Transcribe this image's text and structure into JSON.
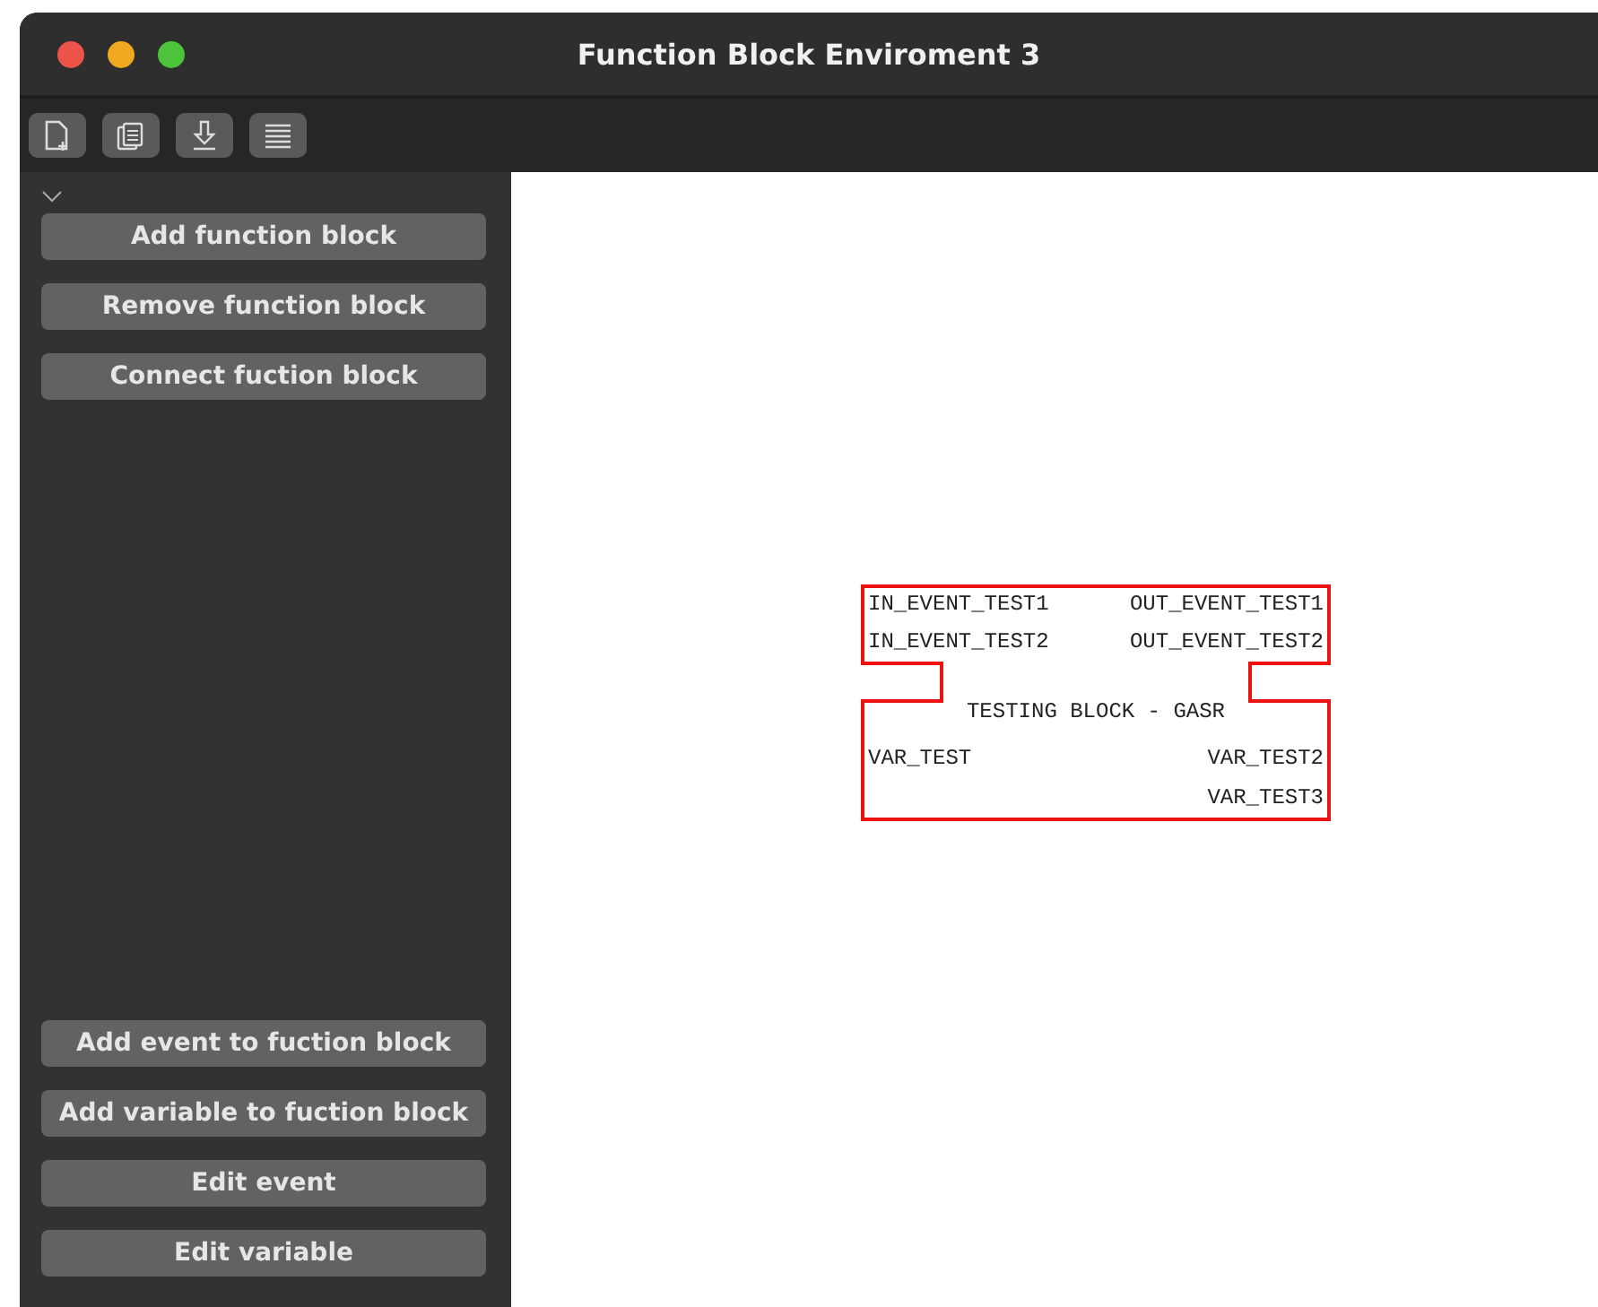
{
  "window": {
    "title": "Function Block Enviroment 3"
  },
  "toolbar": [
    {
      "kind": "new"
    },
    {
      "kind": "copy"
    },
    {
      "kind": "download"
    },
    {
      "kind": "list"
    }
  ],
  "sidebar": {
    "expanded": true,
    "top_buttons": [
      "Add function block",
      "Remove function block",
      "Connect fuction block"
    ],
    "bottom_buttons": [
      "Add event to fuction block",
      "Add variable to fuction block",
      "Edit event",
      "Edit variable"
    ]
  },
  "block": {
    "title": "TESTING BLOCK - GASR",
    "event_inputs": [
      "IN_EVENT_TEST1",
      "IN_EVENT_TEST2"
    ],
    "event_outputs": [
      "OUT_EVENT_TEST1",
      "OUT_EVENT_TEST2"
    ],
    "var_inputs": [
      "VAR_TEST"
    ],
    "var_outputs": [
      "VAR_TEST2",
      "VAR_TEST3"
    ]
  }
}
